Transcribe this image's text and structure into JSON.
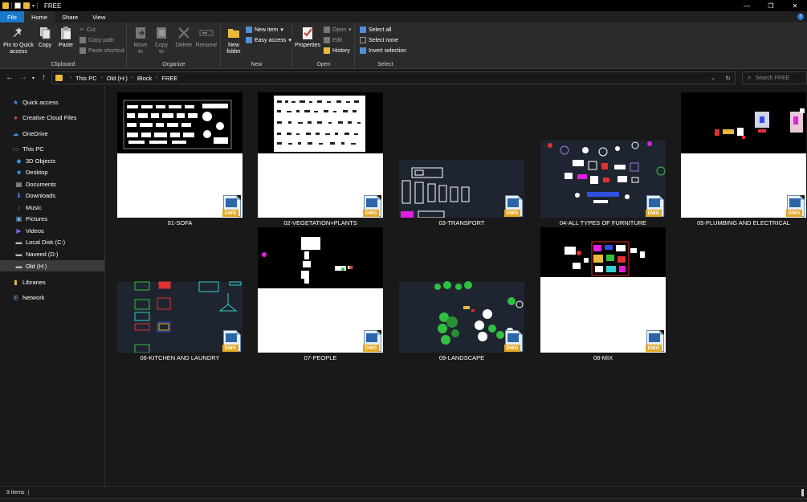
{
  "window": {
    "title": "FREE",
    "controls": [
      "—",
      "❐",
      "✕"
    ]
  },
  "ribbon_tabs": [
    "File",
    "Home",
    "Share",
    "View"
  ],
  "ribbon": {
    "clipboard": {
      "label": "Clipboard",
      "pin": "Pin to Quick access",
      "copy": "Copy",
      "paste": "Paste",
      "cut": "Cut",
      "copy_path": "Copy path",
      "paste_shortcut": "Paste shortcut"
    },
    "organize": {
      "label": "Organize",
      "move_to": "Move to",
      "copy_to": "Copy to",
      "delete": "Delete",
      "rename": "Rename"
    },
    "new": {
      "label": "New",
      "new_folder": "New folder",
      "new_item": "New item",
      "easy_access": "Easy access"
    },
    "open": {
      "label": "Open",
      "properties": "Properties",
      "open": "Open",
      "edit": "Edit",
      "history": "History"
    },
    "select": {
      "label": "Select",
      "select_all": "Select all",
      "select_none": "Select none",
      "invert": "Invert selection"
    }
  },
  "address": {
    "crumbs": [
      "This PC",
      "Old (H:)",
      "Block",
      "FREE"
    ],
    "search_placeholder": "Search FREE"
  },
  "nav": [
    {
      "label": "Quick access",
      "icon": "star-icon",
      "color": "#3d8ee6"
    },
    {
      "label": "Creative Cloud Files",
      "icon": "creative-cloud-icon",
      "color": "#d94f3d"
    },
    {
      "label": "OneDrive",
      "icon": "cloud-icon",
      "color": "#3d8ee6"
    },
    {
      "label": "This PC",
      "icon": "computer-icon",
      "color": "#3d8ee6"
    },
    {
      "label": "3D Objects",
      "icon": "cube-icon",
      "color": "#3d8ee6"
    },
    {
      "label": "Desktop",
      "icon": "desktop-icon",
      "color": "#3d8ee6"
    },
    {
      "label": "Documents",
      "icon": "documents-icon",
      "color": "#d6d6d6"
    },
    {
      "label": "Downloads",
      "icon": "download-icon",
      "color": "#3d8ee6"
    },
    {
      "label": "Music",
      "icon": "music-icon",
      "color": "#3d8ee6"
    },
    {
      "label": "Pictures",
      "icon": "pictures-icon",
      "color": "#6fb3e8"
    },
    {
      "label": "Videos",
      "icon": "videos-icon",
      "color": "#6f6fe8"
    },
    {
      "label": "Local Disk (C:)",
      "icon": "drive-icon",
      "color": "#bbbbbb"
    },
    {
      "label": "Naveed (D:)",
      "icon": "drive-icon",
      "color": "#bbbbbb"
    },
    {
      "label": "Old (H:)",
      "icon": "drive-icon",
      "color": "#bbbbbb"
    },
    {
      "label": "Libraries",
      "icon": "libraries-icon",
      "color": "#e8b93a"
    },
    {
      "label": "Network",
      "icon": "network-icon",
      "color": "#3d8ee6"
    }
  ],
  "files": [
    {
      "name": "01-SOFA",
      "badge": "DWG"
    },
    {
      "name": "02-VEGETATION+PLANTS",
      "badge": "DWG"
    },
    {
      "name": "03-TRANSPORT",
      "badge": "DWG"
    },
    {
      "name": "04-ALL TYPES OF FURNITURE",
      "badge": "DWG"
    },
    {
      "name": "05-PLUMBING AND ELECTRICAL",
      "badge": "DWG"
    },
    {
      "name": "06-KITCHEN AND LAUNDRY",
      "badge": "DWG"
    },
    {
      "name": "07-PEOPLE",
      "badge": "DWG"
    },
    {
      "name": "09-LANDSCAPE",
      "badge": "DWG"
    },
    {
      "name": "08-MIX",
      "badge": "DWG"
    }
  ],
  "status": {
    "item_count": "9 items"
  }
}
